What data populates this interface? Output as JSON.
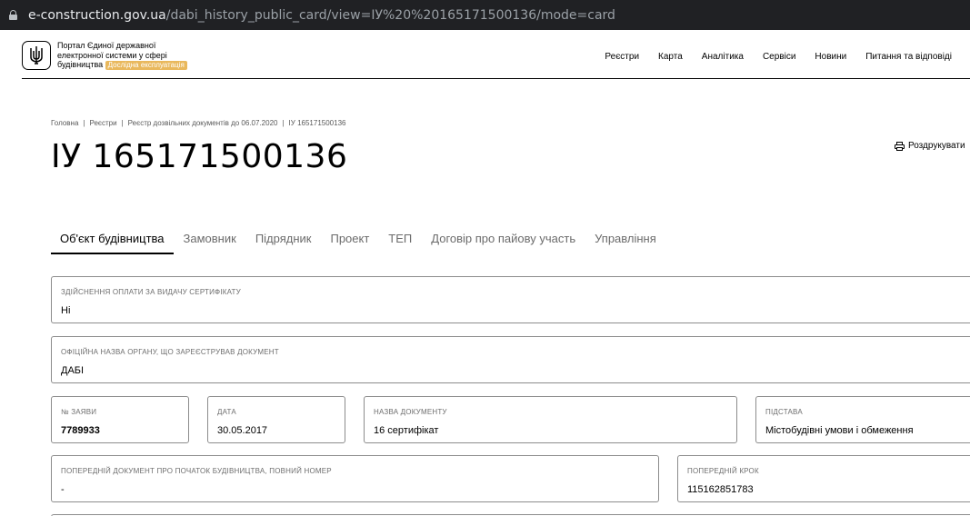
{
  "browser": {
    "url_domain": "e-construction.gov.ua",
    "url_path": "/dabi_history_public_card/view=IУ%20%20165171500136/mode=card"
  },
  "header": {
    "logo_line1": "Портал Єдиної державної",
    "logo_line2": "електронної системи у сфері",
    "logo_line3": "будівництва",
    "beta_badge": "Дослідна експлуатація",
    "nav": [
      "Реєстри",
      "Карта",
      "Аналітика",
      "Сервіси",
      "Новини",
      "Питання та відповіді"
    ]
  },
  "breadcrumb": [
    "Головна",
    "Реєстри",
    "Реєстр дозвільних документів до 06.07.2020",
    "ІУ 165171500136"
  ],
  "page_title": "ІУ 165171500136",
  "print_label": "Роздрукувати",
  "tabs": [
    "Об'єкт будівництва",
    "Замовник",
    "Підрядник",
    "Проект",
    "ТЕП",
    "Договір про пайову участь",
    "Управління"
  ],
  "fields": {
    "payment": {
      "label": "Здійснення оплати за видачу сертифікату",
      "value": "Ні"
    },
    "authority": {
      "label": "Офіційна назва органу, що зареєстрував документ",
      "value": "ДАБІ"
    },
    "application_no": {
      "label": "№ заяви",
      "value": "7789933"
    },
    "date": {
      "label": "Дата",
      "value": "30.05.2017"
    },
    "doc_name": {
      "label": "Назва документу",
      "value": "16 сертифікат"
    },
    "basis": {
      "label": "Підстава",
      "value": "Містобудівні умови і обмеження"
    },
    "prev_doc": {
      "label": "Попередній документ про початок будівництва, повний номер",
      "value": "-"
    },
    "prev_step": {
      "label": "Попередній крок",
      "value": "115162851783"
    }
  },
  "colors": {
    "beta_badge": "#e9b85c",
    "url_bar": "#202124"
  }
}
